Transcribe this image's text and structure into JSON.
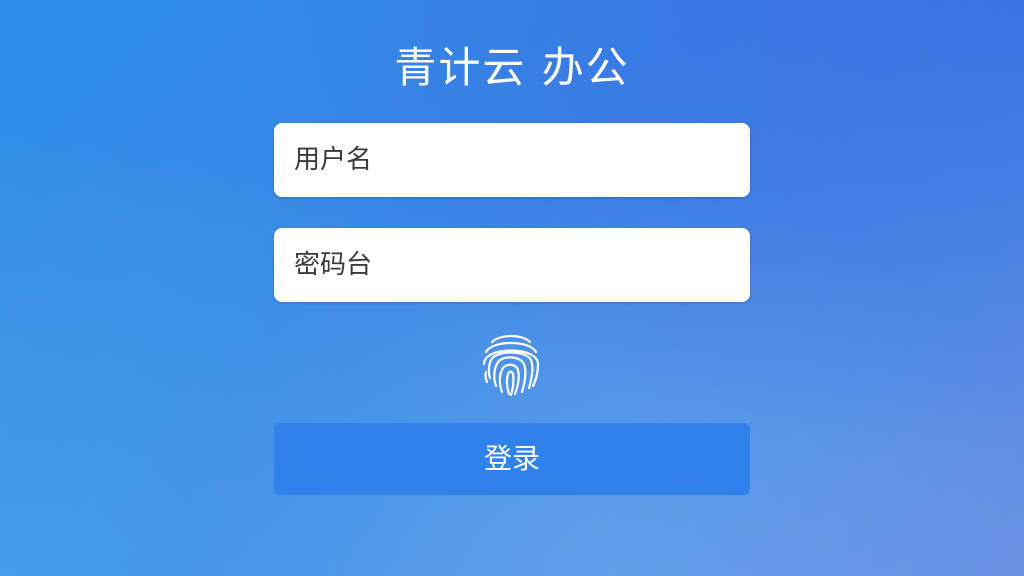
{
  "app": {
    "title": "青计云 办公"
  },
  "form": {
    "username_placeholder": "用户名",
    "username_value": "",
    "password_placeholder": "密码台",
    "password_value": "",
    "login_label": "登录"
  },
  "icons": {
    "fingerprint": "fingerprint-icon"
  },
  "colors": {
    "background_start": "#2f8fe6",
    "background_end": "#6b8fe2",
    "button": "#2f82ec",
    "field": "#ffffff",
    "text_on_blue": "#ffffff"
  }
}
